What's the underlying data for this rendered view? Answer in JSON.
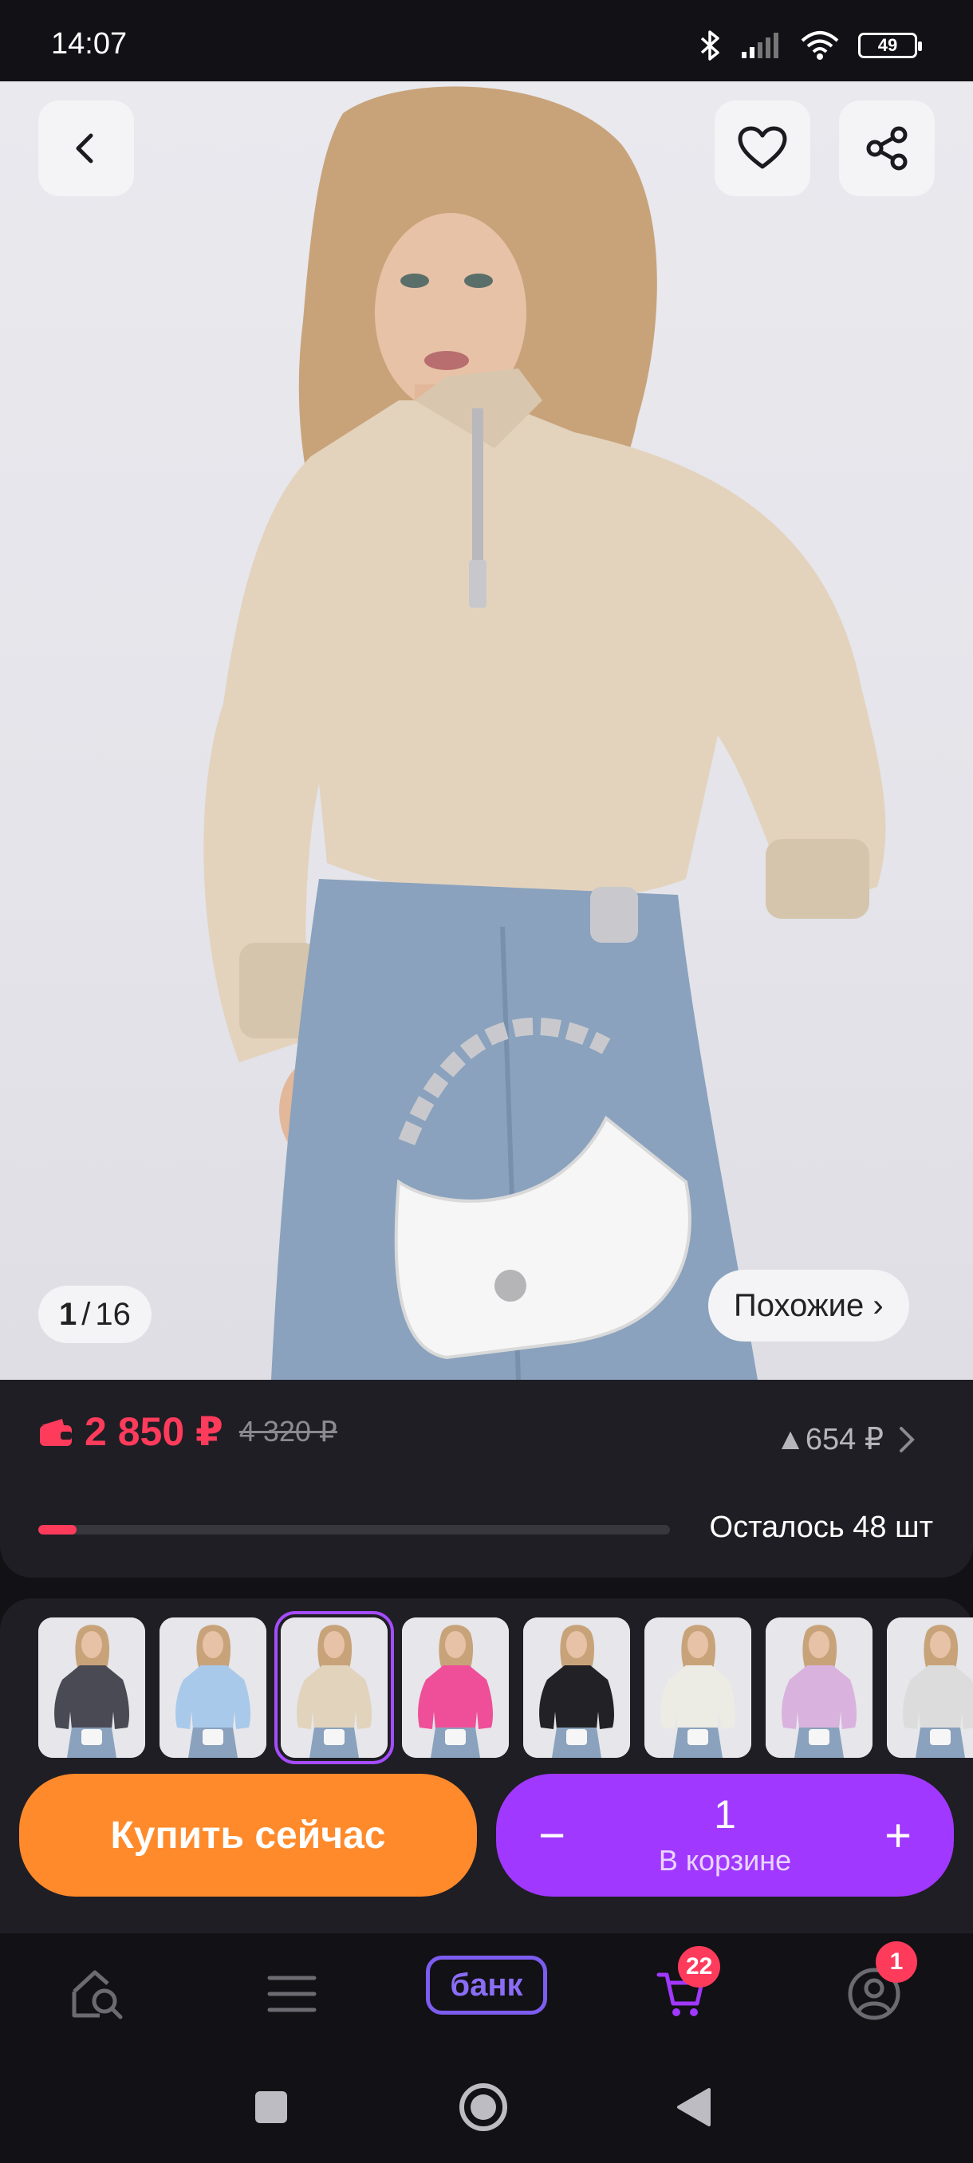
{
  "status_bar": {
    "time": "14:07",
    "battery": "49"
  },
  "gallery": {
    "counter_current": "1",
    "counter_sep": "/",
    "counter_total": "16",
    "similar_label": "Похожие ›"
  },
  "price": {
    "current": "2 850 ₽",
    "old": "4 320 ₽",
    "diff": "▲654 ₽",
    "stock_progress_fraction": 0.06,
    "remaining": "Осталось 48 шт"
  },
  "variants": [
    {
      "name": "graphite",
      "color": "#4a4a55"
    },
    {
      "name": "light-blue",
      "color": "#a9c9ea"
    },
    {
      "name": "beige",
      "color": "#e2d3bd",
      "selected": true
    },
    {
      "name": "pink",
      "color": "#ee4f98"
    },
    {
      "name": "black",
      "color": "#222226"
    },
    {
      "name": "milk",
      "color": "#ecebe4"
    },
    {
      "name": "lilac",
      "color": "#d9b3de"
    },
    {
      "name": "light-gray",
      "color": "#dcdcdc"
    }
  ],
  "actions": {
    "buy_now": "Купить сейчас",
    "cart_qty": "1",
    "cart_label": "В корзине",
    "minus": "−",
    "plus": "+"
  },
  "bottom_nav": {
    "bank_label": "банк",
    "cart_badge": "22",
    "profile_badge": "1"
  },
  "colors": {
    "accent_red": "#ff3b5c",
    "buy_orange": "#ff8a2b",
    "cart_purple": "#a138ff",
    "bank_purple": "#7d5cf0"
  }
}
